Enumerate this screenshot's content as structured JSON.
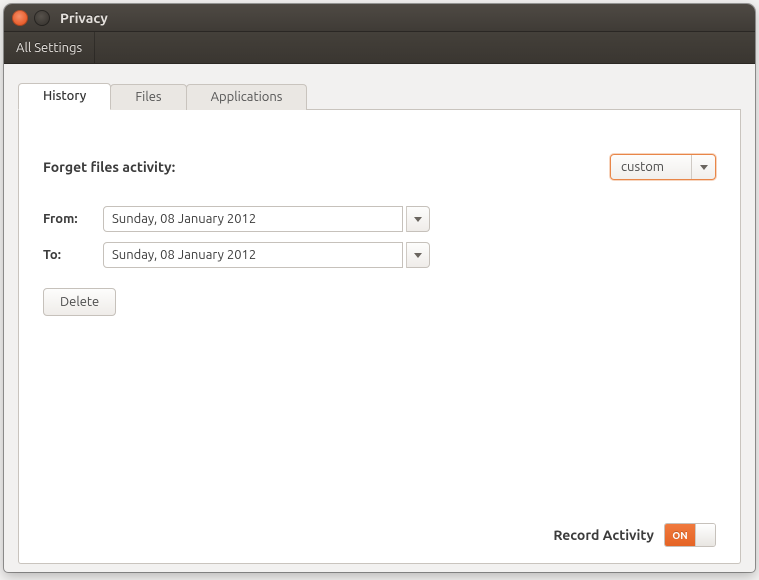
{
  "window": {
    "title": "Privacy"
  },
  "toolbar": {
    "all_settings": "All Settings"
  },
  "tabs": {
    "history": "History",
    "files": "Files",
    "applications": "Applications"
  },
  "panel": {
    "section_label": "Forget files activity:",
    "period_select": {
      "value": "custom"
    },
    "from_label": "From:",
    "to_label": "To:",
    "from_value": "Sunday, 08 January 2012",
    "to_value": "Sunday, 08 January 2012",
    "delete_label": "Delete"
  },
  "footer": {
    "record_activity_label": "Record Activity",
    "switch_on_label": "ON",
    "switch_state": true
  }
}
